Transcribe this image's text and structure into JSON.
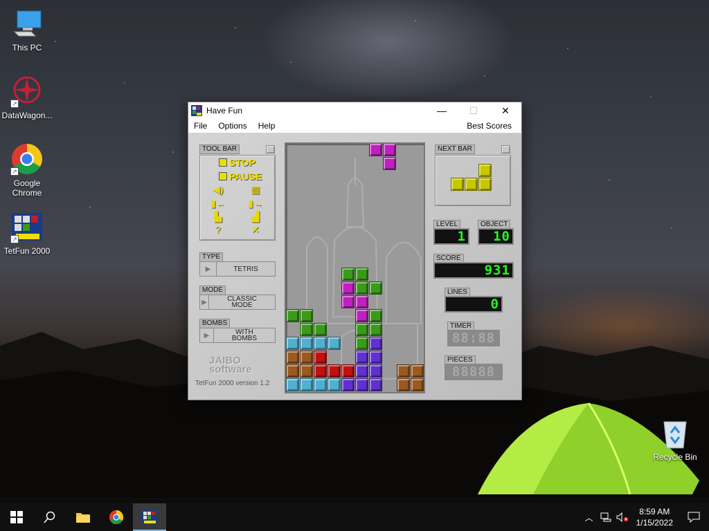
{
  "desktop": {
    "icons": [
      {
        "label": "This PC"
      },
      {
        "label": "DataWagon..."
      },
      {
        "label": "Google Chrome"
      },
      {
        "label": "TetFun 2000"
      },
      {
        "label": "Recycle Bin"
      }
    ]
  },
  "window": {
    "title": "Have Fun",
    "controls": {
      "minimize": "—",
      "maximize": "☐",
      "close": "✕"
    },
    "menu": {
      "file": "File",
      "options": "Options",
      "help": "Help",
      "best_scores": "Best Scores"
    }
  },
  "game": {
    "toolbar": {
      "label": "TOOL BAR",
      "stop": "STOP",
      "pause": "PAUSE",
      "help_glyph": "?",
      "exit_glyph": "✕"
    },
    "type": {
      "label": "TYPE",
      "value": "TETRIS"
    },
    "mode": {
      "label": "MODE",
      "value": "CLASSIC MODE"
    },
    "bombs": {
      "label": "BOMBS",
      "value": "WITH BOMBS"
    },
    "brand": {
      "line1": "JAIBO",
      "line2": "software"
    },
    "version": "TetFun 2000 version 1.2",
    "next_bar": {
      "label": "NEXT BAR"
    },
    "level": {
      "label": "LEVEL",
      "value": "1"
    },
    "object": {
      "label": "OBJECT",
      "value": "10"
    },
    "score": {
      "label": "SCORE",
      "value": "931"
    },
    "lines": {
      "label": "LINES",
      "value": "0"
    },
    "timer": {
      "label": "TIMER",
      "value": "88:88"
    },
    "pieces": {
      "label": "PIECES",
      "value": "88888"
    },
    "colors": {
      "green": "#3a9a1a",
      "magenta": "#c020c0",
      "cyan": "#50b0d0",
      "brown": "#9a5a20",
      "red": "#c01010",
      "purple": "#6030d0",
      "yellow": "#c8c800",
      "led_green": "#20ff20",
      "led_dim": "#5a0c0c"
    }
  },
  "taskbar": {
    "time": "8:59 AM",
    "date": "1/15/2022"
  }
}
